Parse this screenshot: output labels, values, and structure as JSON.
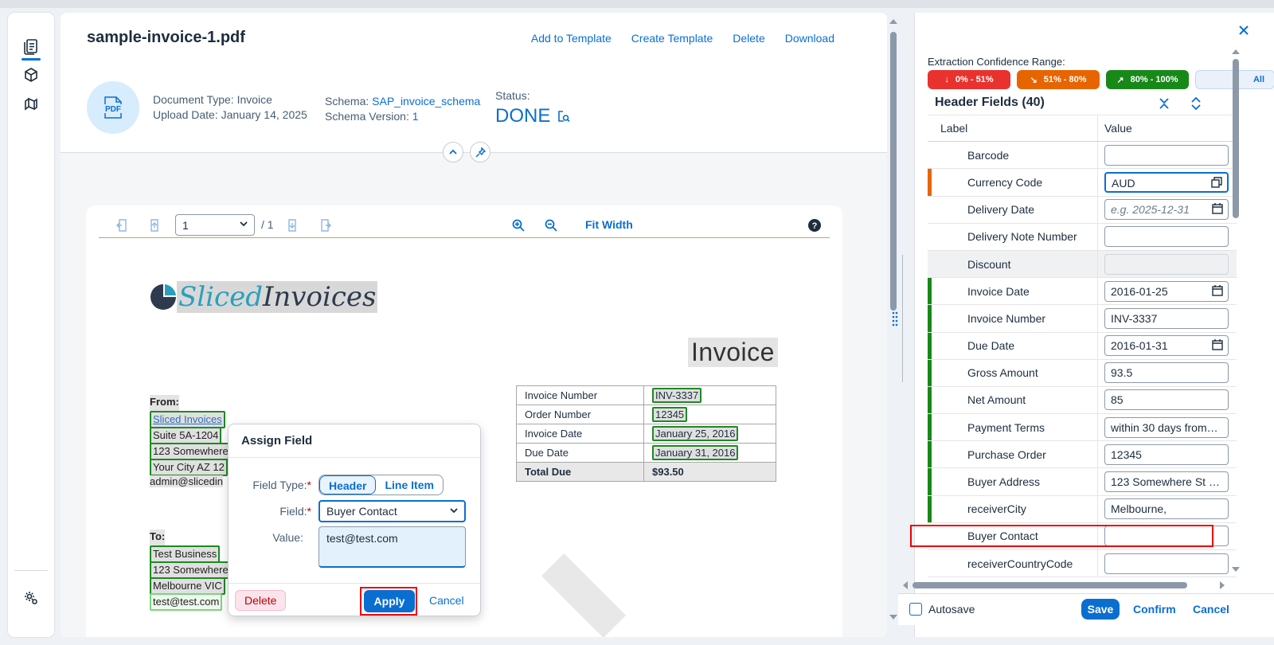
{
  "document": {
    "title": "sample-invoice-1.pdf",
    "actions": [
      "Add to Template",
      "Create Template",
      "Delete",
      "Download"
    ],
    "avatar_text": "PDF",
    "type_label": "Document Type: ",
    "type_value": "Invoice",
    "upload_label": "Upload Date: ",
    "upload_value": "January 14, 2025",
    "schema_label": "Schema: ",
    "schema_value": "SAP_invoice_schema",
    "schema_version_label": "Schema Version: ",
    "schema_version_value": "1",
    "status_label": "Status:",
    "status_value": "DONE"
  },
  "viewer": {
    "page": "1",
    "page_total": "/ 1",
    "fit_width": "Fit Width"
  },
  "invoice": {
    "logo_a": "Sliced",
    "logo_b": "Invoices",
    "heading": "Invoice",
    "from_label": "From:",
    "from_lines": [
      "Sliced Invoices",
      "Suite 5A-1204",
      "123 Somewhere",
      "Your City AZ 12",
      "admin@slicedin"
    ],
    "to_label": "To:",
    "to_lines": [
      "Test Business",
      "123 Somewhere",
      "Melbourne VIC",
      "test@test.com"
    ],
    "table": [
      {
        "label": "Invoice Number",
        "value": "INV-3337"
      },
      {
        "label": "Order Number",
        "value": "12345"
      },
      {
        "label": "Invoice Date",
        "value": "January 25, 2016"
      },
      {
        "label": "Due Date",
        "value": "January 31, 2016"
      },
      {
        "label": "Total Due",
        "value": "$93.50"
      }
    ]
  },
  "popover": {
    "title": "Assign Field",
    "field_type_label": "Field Type:",
    "field_type_options": [
      "Header",
      "Line Item"
    ],
    "field_label": "Field:",
    "field_value": "Buyer Contact",
    "value_label": "Value:",
    "value_text": "test@test.com",
    "delete": "Delete",
    "apply": "Apply",
    "cancel": "Cancel"
  },
  "panel": {
    "confidence_label": "Extraction Confidence Range:",
    "chips": [
      "0% - 51%",
      "51% - 80%",
      "80% - 100%",
      "All"
    ],
    "section_title": "Header Fields (40)",
    "col_label": "Label",
    "col_value": "Value",
    "rows": [
      {
        "label": "Barcode",
        "value": ""
      },
      {
        "label": "Currency Code",
        "value": "AUD"
      },
      {
        "label": "Delivery Date",
        "value": "e.g. 2025-12-31"
      },
      {
        "label": "Delivery Note Number",
        "value": ""
      },
      {
        "label": "Discount",
        "value": ""
      },
      {
        "label": "Invoice Date",
        "value": "2016-01-25"
      },
      {
        "label": "Invoice Number",
        "value": "INV-3337"
      },
      {
        "label": "Due Date",
        "value": "2016-01-31"
      },
      {
        "label": "Gross Amount",
        "value": "93.5"
      },
      {
        "label": "Net Amount",
        "value": "85"
      },
      {
        "label": "Payment Terms",
        "value": "within 30 days from…"
      },
      {
        "label": "Purchase Order",
        "value": "12345"
      },
      {
        "label": "Buyer Address",
        "value": "123 Somewhere St …"
      },
      {
        "label": "receiverCity",
        "value": "Melbourne,"
      },
      {
        "label": "Buyer Contact",
        "value": ""
      },
      {
        "label": "receiverCountryCode",
        "value": ""
      }
    ],
    "autosave": "Autosave",
    "save": "Save",
    "confirm": "Confirm",
    "cancel": "Cancel"
  },
  "colors": {
    "accent": "#0a6ed1",
    "green": "#188918",
    "orange": "#e76500",
    "red": "#e9322d",
    "highlight": "#ee0000"
  }
}
